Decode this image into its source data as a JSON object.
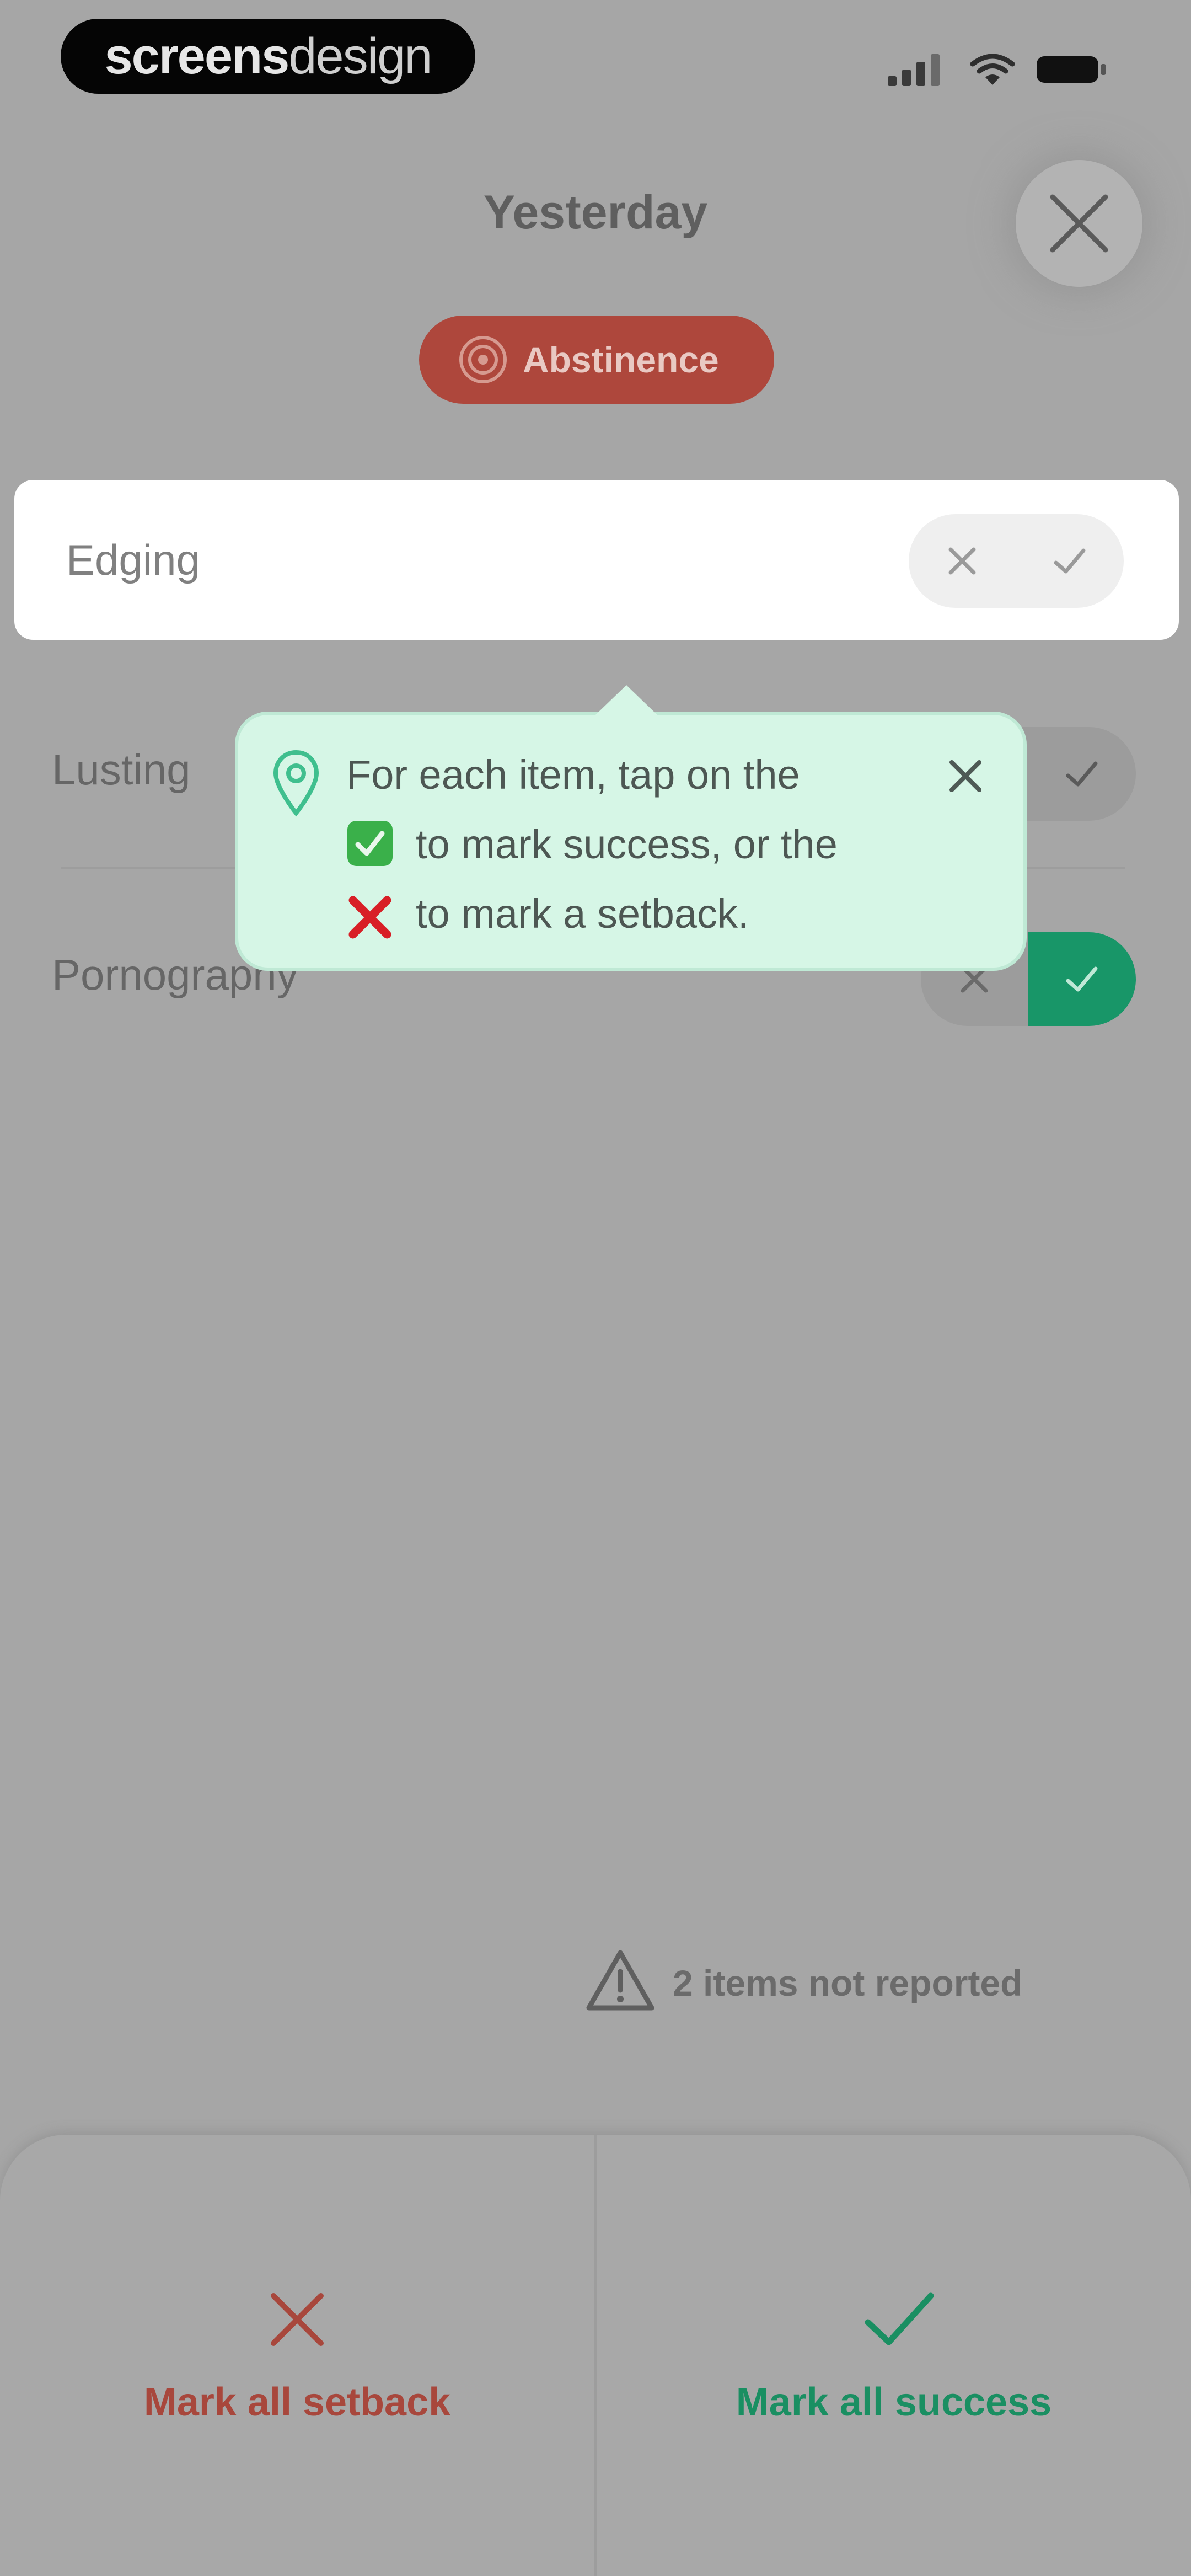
{
  "status_bar": {
    "brand_bold": "screens",
    "brand_light": "design"
  },
  "header": {
    "title": "Yesterday",
    "chip_label": "Abstinence",
    "chip_icon": "target-icon",
    "close_icon": "close-icon"
  },
  "items": [
    {
      "label": "Edging",
      "state": "none"
    },
    {
      "label": "Lusting",
      "state": "none"
    },
    {
      "label": "Pornography",
      "state": "success"
    }
  ],
  "tooltip": {
    "line1": "For each item, tap on the",
    "line2": "to mark success, or the",
    "line3": "to mark a setback.",
    "icon": "map-pin-icon"
  },
  "warning": {
    "text": "2 items not reported",
    "icon": "warning-triangle-icon"
  },
  "bottom": {
    "setback_label": "Mark all setback",
    "success_label": "Mark all success"
  },
  "colors": {
    "setback": "#a8473c",
    "success": "#189668",
    "tooltip_bg": "#d6f6e6",
    "chip_bg": "#ae473c"
  }
}
